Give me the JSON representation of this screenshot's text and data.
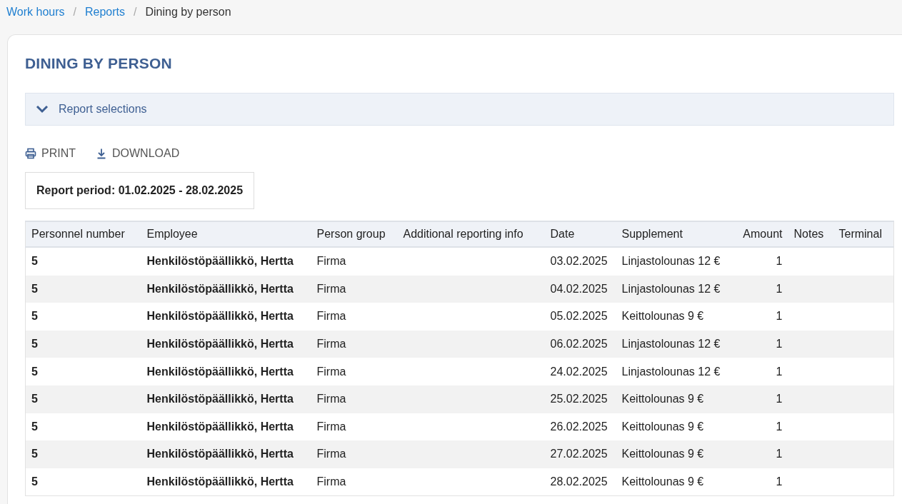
{
  "breadcrumb": [
    {
      "label": "Work hours",
      "link": true
    },
    {
      "label": "Reports",
      "link": true
    },
    {
      "label": "Dining by person",
      "link": false
    }
  ],
  "title": "DINING BY PERSON",
  "selections": {
    "label": "Report selections",
    "expanded": false
  },
  "breadcrumb_separator": "/",
  "actions": [
    {
      "label": "PRINT",
      "kind": "print"
    },
    {
      "label": "DOWNLOAD",
      "kind": "download"
    }
  ],
  "report_period": "Report period: 01.02.2025 - 28.02.2025",
  "table": {
    "columns": [
      "Personnel number",
      "Employee",
      "Person group",
      "Additional reporting info",
      "Date",
      "Supplement",
      "Amount",
      "Notes",
      "Terminal"
    ],
    "rows": [
      {
        "personnel_number": "5",
        "employee": "Henkilöstöpäällikkö, Hertta",
        "person_group": "Firma",
        "date": "03.02.2025",
        "supplement": "Linjastolounas 12 €",
        "amount": "1"
      },
      {
        "personnel_number": "5",
        "employee": "Henkilöstöpäällikkö, Hertta",
        "person_group": "Firma",
        "date": "04.02.2025",
        "supplement": "Linjastolounas 12 €",
        "amount": "1"
      },
      {
        "personnel_number": "5",
        "employee": "Henkilöstöpäällikkö, Hertta",
        "person_group": "Firma",
        "date": "05.02.2025",
        "supplement": "Keittolounas 9 €",
        "amount": "1"
      },
      {
        "personnel_number": "5",
        "employee": "Henkilöstöpäällikkö, Hertta",
        "person_group": "Firma",
        "date": "06.02.2025",
        "supplement": "Linjastolounas 12 €",
        "amount": "1"
      },
      {
        "personnel_number": "5",
        "employee": "Henkilöstöpäällikkö, Hertta",
        "person_group": "Firma",
        "date": "24.02.2025",
        "supplement": "Linjastolounas 12 €",
        "amount": "1"
      },
      {
        "personnel_number": "5",
        "employee": "Henkilöstöpäällikkö, Hertta",
        "person_group": "Firma",
        "date": "25.02.2025",
        "supplement": "Keittolounas 9 €",
        "amount": "1"
      },
      {
        "personnel_number": "5",
        "employee": "Henkilöstöpäällikkö, Hertta",
        "person_group": "Firma",
        "date": "26.02.2025",
        "supplement": "Keittolounas 9 €",
        "amount": "1"
      },
      {
        "personnel_number": "5",
        "employee": "Henkilöstöpäällikkö, Hertta",
        "person_group": "Firma",
        "date": "27.02.2025",
        "supplement": "Keittolounas 9 €",
        "amount": "1"
      },
      {
        "personnel_number": "5",
        "employee": "Henkilöstöpäällikkö, Hertta",
        "person_group": "Firma",
        "date": "28.02.2025",
        "supplement": "Keittolounas 9 €",
        "amount": "1"
      }
    ]
  }
}
